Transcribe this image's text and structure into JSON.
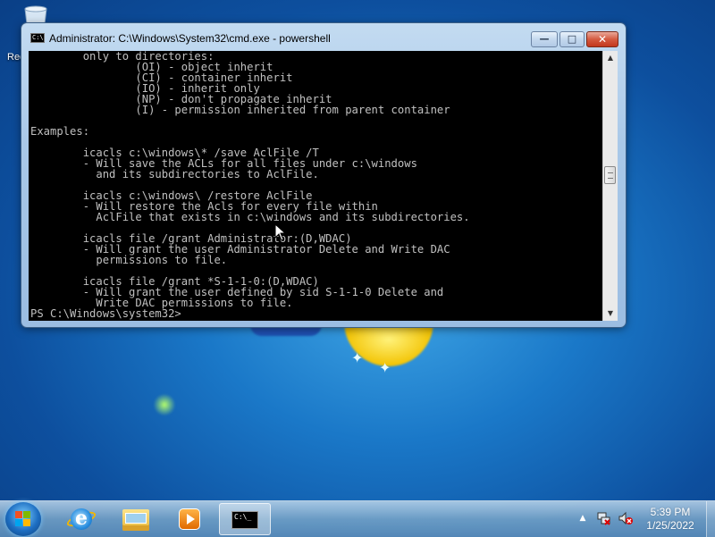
{
  "desktop": {
    "recycle_label": "Rec"
  },
  "window": {
    "title": "Administrator: C:\\Windows\\System32\\cmd.exe - powershell",
    "icon_text": "C:\\",
    "controls": {
      "minimize": "—",
      "maximize": "□",
      "close": "✕"
    },
    "console_lines": [
      "        only to directories:",
      "                (OI) - object inherit",
      "                (CI) - container inherit",
      "                (IO) - inherit only",
      "                (NP) - don't propagate inherit",
      "                (I) - permission inherited from parent container",
      "",
      "Examples:",
      "",
      "        icacls c:\\windows\\* /save AclFile /T",
      "        - Will save the ACLs for all files under c:\\windows",
      "          and its subdirectories to AclFile.",
      "",
      "        icacls c:\\windows\\ /restore AclFile",
      "        - Will restore the Acls for every file within",
      "          AclFile that exists in c:\\windows and its subdirectories.",
      "",
      "        icacls file /grant Administrator:(D,WDAC)",
      "        - Will grant the user Administrator Delete and Write DAC",
      "          permissions to file.",
      "",
      "        icacls file /grant *S-1-1-0:(D,WDAC)",
      "        - Will grant the user defined by sid S-1-1-0 Delete and",
      "          Write DAC permissions to file.",
      "PS C:\\Windows\\system32>"
    ]
  },
  "taskbar": {
    "pinned": [
      {
        "name": "internet-explorer-icon"
      },
      {
        "name": "windows-explorer-icon"
      },
      {
        "name": "media-player-icon"
      },
      {
        "name": "command-prompt-icon",
        "active": true
      }
    ],
    "cmd_icon_text": "C:\\_",
    "tray_arrow": "▲",
    "clock": {
      "time": "5:39 PM",
      "date": "1/25/2022"
    }
  },
  "colors": {
    "console_bg": "#000000",
    "console_fg": "#c0c0c0",
    "close_button": "#c3381e"
  }
}
